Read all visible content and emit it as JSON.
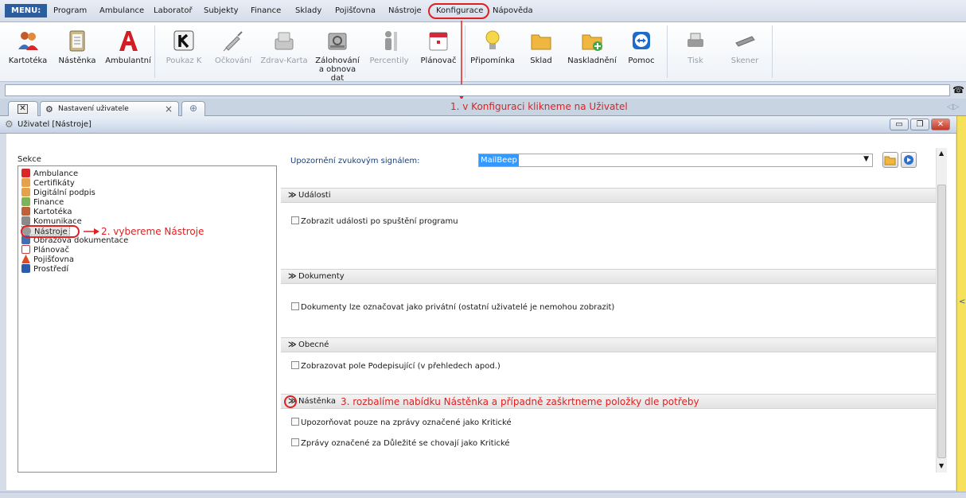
{
  "menubar": {
    "label": "MENU:",
    "items": [
      "Program",
      "Ambulance",
      "Laboratoř",
      "Subjekty",
      "Finance",
      "Sklady",
      "Pojišťovna",
      "Nástroje",
      "Konfigurace",
      "Nápověda"
    ]
  },
  "toolbar": {
    "buttons": [
      {
        "label": "Kartotéka",
        "icon": "people-icon",
        "enabled": true
      },
      {
        "label": "Nástěnka",
        "icon": "clipboard-icon",
        "enabled": true
      },
      {
        "label": "Ambulantní",
        "icon": "red-a-icon",
        "enabled": true
      },
      {
        "label": "Poukaz K",
        "icon": "k-letter-icon",
        "enabled": false
      },
      {
        "label": "Očkování",
        "icon": "syringe-icon",
        "enabled": false
      },
      {
        "label": "Zdrav-Karta",
        "icon": "card-reader-icon",
        "enabled": false
      },
      {
        "label": "Zálohování a obnova dat",
        "icon": "backup-drive-icon",
        "enabled": true
      },
      {
        "label": "Percentily",
        "icon": "growth-chart-icon",
        "enabled": false
      },
      {
        "label": "Plánovač",
        "icon": "calendar-icon",
        "enabled": true
      },
      {
        "label": "Připomínka",
        "icon": "lightbulb-icon",
        "enabled": true
      },
      {
        "label": "Sklad",
        "icon": "folder-icon",
        "enabled": true
      },
      {
        "label": "Naskladnění",
        "icon": "folder-add-icon",
        "enabled": true
      },
      {
        "label": "Pomoc",
        "icon": "teamviewer-icon",
        "enabled": true
      },
      {
        "label": "Tisk",
        "icon": "printer-icon",
        "enabled": false
      },
      {
        "label": "Skener",
        "icon": "scanner-icon",
        "enabled": false
      }
    ]
  },
  "tabs": {
    "active_label": "Nastavení uživatele",
    "close_glyph": "×"
  },
  "window": {
    "title": "Uživatel [Nástroje]"
  },
  "sekce": {
    "label": "Sekce",
    "items": [
      {
        "label": "Ambulance",
        "color": "#d9262b"
      },
      {
        "label": "Certifikáty",
        "color": "#e5a24a"
      },
      {
        "label": "Digitální podpis",
        "color": "#e5a24a"
      },
      {
        "label": "Finance",
        "color": "#7db35a"
      },
      {
        "label": "Kartotéka",
        "color": "#c0603a"
      },
      {
        "label": "Komunikace",
        "color": "#8a8a8a"
      },
      {
        "label": "Nástroje",
        "color": "#9a9a9a"
      },
      {
        "label": "Obrazová dokumentace",
        "color": "#3f6fb5"
      },
      {
        "label": "Plánovač",
        "color": "#c33b3b"
      },
      {
        "label": "Pojišťovna",
        "color": "#d94c2a"
      },
      {
        "label": "Prostředí",
        "color": "#2a5cae"
      }
    ],
    "selected": "Nástroje"
  },
  "settings": {
    "sound_label": "Upozornění zvukovým signálem:",
    "sound_value": "MailBeep",
    "sections": [
      {
        "title": "Události",
        "options": [
          "Zobrazit události po spuštění programu"
        ]
      },
      {
        "title": "Dokumenty",
        "options": [
          "Dokumenty lze označovat jako privátní (ostatní uživatelé je nemohou zobrazit)"
        ]
      },
      {
        "title": "Obecné",
        "options": [
          "Zobrazovat pole Podepisující (v přehledech apod.)"
        ]
      },
      {
        "title": "Nástěnka",
        "options": [
          "Upozorňovat pouze na zprávy označené jako Kritické",
          "Zprávy označené za Důležité se chovají jako Kritické"
        ]
      }
    ]
  },
  "annotations": {
    "step1": "1. v Konfiguraci klikneme na Uživatel",
    "step2": "2. vybereme Nástroje",
    "step3": "3. rozbalíme nabídku Nástěnka a případně zaškrtneme položky dle potřeby",
    "accent": "#e02020"
  }
}
